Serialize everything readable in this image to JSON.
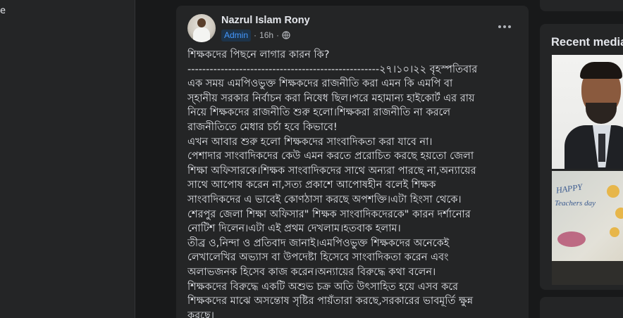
{
  "left_panel": {
    "fragment": "e"
  },
  "post": {
    "author": "Nazrul Islam Rony",
    "badge": "Admin",
    "separator": "·",
    "time": "16h",
    "separator2": "·",
    "privacy_icon": "globe-icon",
    "more_icon": "more-options-icon",
    "lines": [
      "শিক্ষকদের পিছনে লাগার কারন কি?",
      "----------------------------------------------------২৭।১০।২২ বৃহস্পতিবার",
      "এক সময় এমপিওভুক্ত শিক্ষকদের রাজনীতি করা এমন কি এমপি বা",
      "স্হানীয় সরকার নির্বাচন করা নিষেধ ছিল।পরে মহামান্য হাইকোর্ট এর রায়",
      "নিয়ে শিক্ষকদের রাজনীতি শুরু হলো।শিক্ষকরা রাজনীতি না করলে",
      "রাজনীতিতে মেধার চর্চা  হবে কিভাবে!",
      "এখন আবার শুরু হলো শিক্ষকদের সাংবাদিকতা করা যাবে না।",
      "পেশাদার সাংবাদিকদের কেউ এমন করতে প্ররোচিত করছে হয়তো জেলা",
      "শিক্ষা অফিসারকে।শিক্ষক সাংবাদিকদের সাথে অন্যরা পারছে না,অন্যায়ের",
      "সাথে আপোষ করেন না,সত্য প্রকাশে আপোষহীন বলেই শিক্ষক",
      "সাংবাদিকদের এ ভাবেই কোণঠাসা করছে অপশক্তি।এটা হিংসা থেকে।",
      "শেরপুর জেলা শিক্ষা অফিসার\" শিক্ষক সাংবাদিকদেরকে\" কারন দর্শানোর",
      "নোটিশ দিলেন।এটা এই প্রথম দেখলাম।হতবাক হলাম।",
      "তীব্র ও,নিন্দা ও প্রতিবাদ জানাই।এমপিওভুক্ত শিক্ষকদের অনেকেই",
      "লেখালেখির অভ্যাস বা উপদেষ্টা হিসেবে সাংবাদিকতা করেন এবং",
      "অলাভজনক হিসেব কাজ করেন।অন্যায়ের বিরুদ্ধে কথা বলেন।",
      "শিক্ষকদের বিরুদ্ধে একটি অশুভ চক্র অতি উৎসাহিত হয়ে এসব করে",
      "শিক্ষকদের মাঝে অসন্তোষ সৃষ্টির পায়ঁতারা করছে,সরকারের ভাবমূর্তি ক্ষুন্ন",
      "করছে।"
    ]
  },
  "sidebar": {
    "recent_media_title": "Recent media",
    "photos": [
      {
        "name": "portrait-photo"
      },
      {
        "name": "teachers-day-photo",
        "text_line1": "HAPPY",
        "text_line2": "Teachers day"
      }
    ]
  },
  "colors": {
    "page_bg": "#18191a",
    "card_bg": "#242526",
    "text_primary": "#e4e6eb",
    "text_secondary": "#b0b3b8",
    "admin_badge_bg": "#1d3349",
    "admin_badge_text": "#4599ff"
  }
}
